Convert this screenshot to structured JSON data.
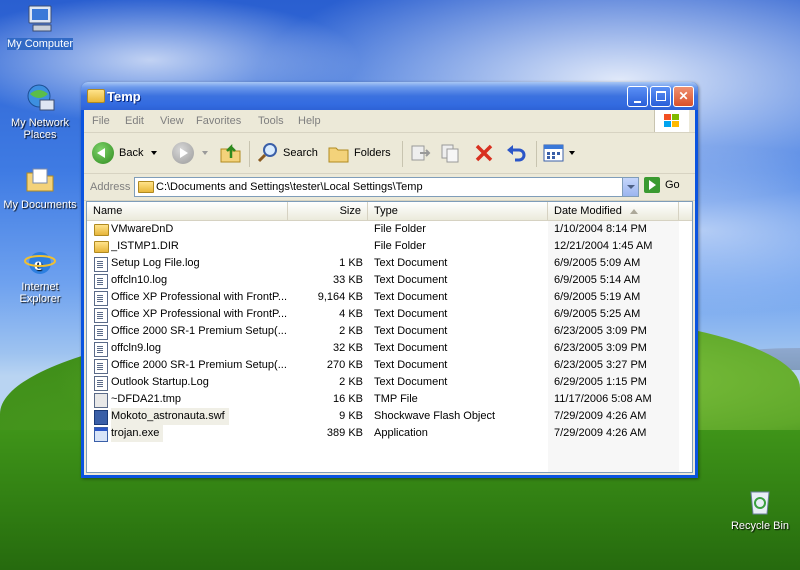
{
  "desktop": {
    "icons": [
      {
        "label": "My Computer",
        "icon": "computer-icon"
      },
      {
        "label": "My Network Places",
        "icon": "network-icon"
      },
      {
        "label": "My Documents",
        "icon": "documents-folder-icon"
      },
      {
        "label": "Internet Explorer",
        "icon": "internet-explorer-icon"
      },
      {
        "label": "Recycle Bin",
        "icon": "recycle-bin-icon"
      }
    ]
  },
  "window": {
    "title": "Temp",
    "menu": [
      "File",
      "Edit",
      "View",
      "Favorites",
      "Tools",
      "Help"
    ],
    "toolbar": {
      "back_label": "Back",
      "search_label": "Search",
      "folders_label": "Folders"
    },
    "address": {
      "label": "Address",
      "value": "C:\\Documents and Settings\\tester\\Local Settings\\Temp",
      "go_label": "Go"
    },
    "columns": {
      "name": "Name",
      "size": "Size",
      "type": "Type",
      "date": "Date Modified"
    },
    "files": [
      {
        "name": "VMwareDnD",
        "size": "",
        "type": "File Folder",
        "date": "1/10/2004 8:14 PM",
        "icon": "folder"
      },
      {
        "name": "_ISTMP1.DIR",
        "size": "",
        "type": "File Folder",
        "date": "12/21/2004 1:45 AM",
        "icon": "folder"
      },
      {
        "name": "Setup Log File.log",
        "size": "1 KB",
        "type": "Text Document",
        "date": "6/9/2005 5:09 AM",
        "icon": "doc"
      },
      {
        "name": "offcln10.log",
        "size": "33 KB",
        "type": "Text Document",
        "date": "6/9/2005 5:14 AM",
        "icon": "doc"
      },
      {
        "name": "Office XP Professional with FrontP...",
        "size": "9,164 KB",
        "type": "Text Document",
        "date": "6/9/2005 5:19 AM",
        "icon": "doc"
      },
      {
        "name": "Office XP Professional with FrontP...",
        "size": "4 KB",
        "type": "Text Document",
        "date": "6/9/2005 5:25 AM",
        "icon": "doc"
      },
      {
        "name": "Office 2000 SR-1 Premium Setup(...",
        "size": "2 KB",
        "type": "Text Document",
        "date": "6/23/2005 3:09 PM",
        "icon": "doc"
      },
      {
        "name": "offcln9.log",
        "size": "32 KB",
        "type": "Text Document",
        "date": "6/23/2005 3:09 PM",
        "icon": "doc"
      },
      {
        "name": "Office 2000 SR-1 Premium Setup(...",
        "size": "270 KB",
        "type": "Text Document",
        "date": "6/23/2005 3:27 PM",
        "icon": "doc"
      },
      {
        "name": "Outlook Startup.Log",
        "size": "2 KB",
        "type": "Text Document",
        "date": "6/29/2005 1:15 PM",
        "icon": "doc"
      },
      {
        "name": "~DFDA21.tmp",
        "size": "16 KB",
        "type": "TMP File",
        "date": "11/17/2006 5:08 AM",
        "icon": "tmp"
      },
      {
        "name": "Mokoto_astronauta.swf",
        "size": "9 KB",
        "type": "Shockwave Flash Object",
        "date": "7/29/2009 4:26 AM",
        "icon": "swf",
        "highlight": true
      },
      {
        "name": "trojan.exe",
        "size": "389 KB",
        "type": "Application",
        "date": "7/29/2009 4:26 AM",
        "icon": "exe",
        "highlight": true
      }
    ]
  },
  "colors": {
    "titlebar": "#2e62d6",
    "close_button": "#d8502a",
    "window_frame": "#ece9d8"
  }
}
